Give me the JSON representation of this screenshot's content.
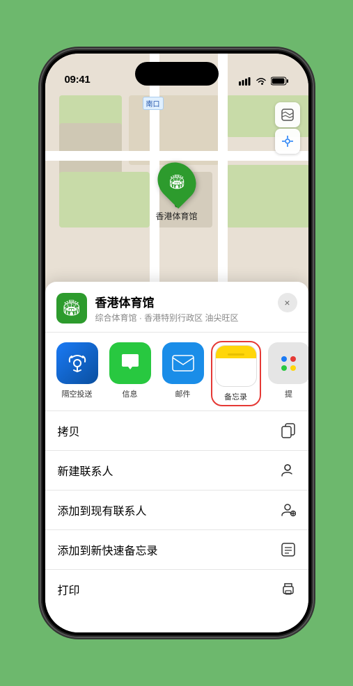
{
  "statusBar": {
    "time": "09:41",
    "locationIcon": "▶"
  },
  "map": {
    "label": "南口",
    "controls": {
      "mapTypeIcon": "map",
      "locationIcon": "location"
    },
    "pin": {
      "label": "香港体育馆"
    }
  },
  "bottomSheet": {
    "venueName": "香港体育馆",
    "venueSubtitle": "综合体育馆 · 香港特别行政区 油尖旺区",
    "closeLabel": "×",
    "shareItems": [
      {
        "id": "airdrop",
        "label": "隔空投送"
      },
      {
        "id": "messages",
        "label": "信息"
      },
      {
        "id": "mail",
        "label": "邮件"
      },
      {
        "id": "notes",
        "label": "备忘录"
      },
      {
        "id": "more",
        "label": "提"
      }
    ],
    "actions": [
      {
        "label": "拷贝",
        "icon": "copy"
      },
      {
        "label": "新建联系人",
        "icon": "person-add"
      },
      {
        "label": "添加到现有联系人",
        "icon": "person-plus"
      },
      {
        "label": "添加到新快速备忘录",
        "icon": "note"
      },
      {
        "label": "打印",
        "icon": "print"
      }
    ]
  }
}
